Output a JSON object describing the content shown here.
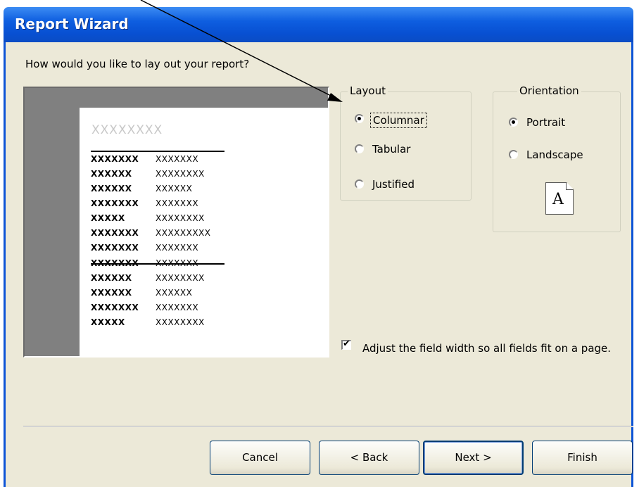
{
  "window": {
    "title": "Report Wizard"
  },
  "prompt": "How would you like to lay out your report?",
  "preview": {
    "title": "XXXXXXXX",
    "rows": [
      {
        "label": "XXXXXXX",
        "value": "XXXXXXX"
      },
      {
        "label": "XXXXXX",
        "value": "XXXXXXXX"
      },
      {
        "label": "XXXXXX",
        "value": "XXXXXX"
      },
      {
        "label": "XXXXXXX",
        "value": "XXXXXXX"
      },
      {
        "label": "XXXXX",
        "value": "XXXXXXXX"
      },
      {
        "label": "XXXXXXX",
        "value": "XXXXXXXXX"
      },
      {
        "label": "XXXXXXX",
        "value": "XXXXXXX"
      },
      {
        "label": "XXXXXXX",
        "value": "XXXXXXX"
      },
      {
        "label": "XXXXXX",
        "value": "XXXXXXXX"
      },
      {
        "label": "XXXXXX",
        "value": "XXXXXX"
      },
      {
        "label": "XXXXXXX",
        "value": "XXXXXXX"
      },
      {
        "label": "XXXXX",
        "value": "XXXXXXXX"
      }
    ]
  },
  "layout": {
    "label": "Layout",
    "options": [
      {
        "label": "Columnar",
        "checked": true
      },
      {
        "label": "Tabular",
        "checked": false
      },
      {
        "label": "Justified",
        "checked": false
      }
    ]
  },
  "orientation": {
    "label": "Orientation",
    "options": [
      {
        "label": "Portrait",
        "checked": true
      },
      {
        "label": "Landscape",
        "checked": false
      }
    ],
    "icon_letter": "A"
  },
  "adjust_checkbox": {
    "label": "Adjust the field width so all fields fit on a page.",
    "checked": true,
    "check_glyph": "✔"
  },
  "buttons": {
    "cancel": "Cancel",
    "back": "< Back",
    "next": "Next >",
    "finish": "Finish"
  },
  "colors": {
    "titlebar": "#0850d2",
    "dialog": "#ece9d8",
    "preview_bg": "#808080"
  }
}
